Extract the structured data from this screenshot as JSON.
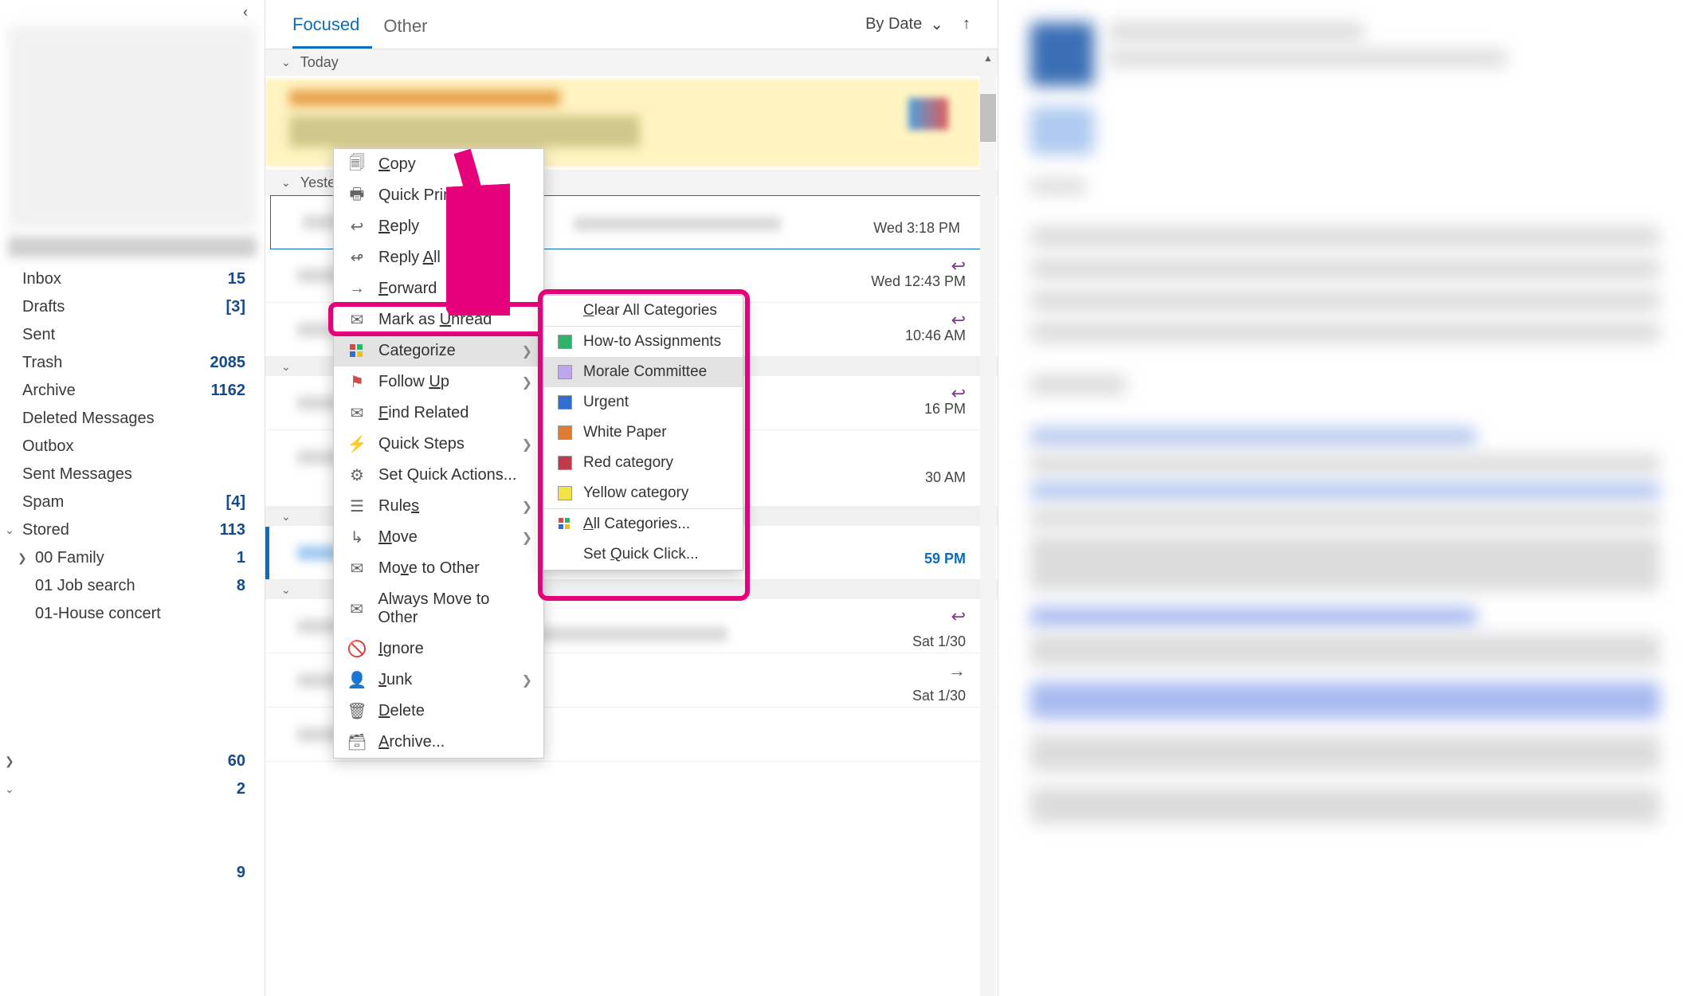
{
  "sidebar": {
    "folders": [
      {
        "name": "Inbox",
        "count": "15"
      },
      {
        "name": "Drafts",
        "count": "[3]"
      },
      {
        "name": "Sent",
        "count": ""
      },
      {
        "name": "Trash",
        "count": "2085"
      },
      {
        "name": "Archive",
        "count": "1162"
      },
      {
        "name": "Deleted Messages",
        "count": ""
      },
      {
        "name": "Outbox",
        "count": ""
      },
      {
        "name": "Sent Messages",
        "count": ""
      },
      {
        "name": "Spam",
        "count": "[4]"
      },
      {
        "name": "Stored",
        "count": "113",
        "expandable": true,
        "expanded": true
      },
      {
        "name": "00 Family",
        "count": "1",
        "level": 1,
        "expandable": true
      },
      {
        "name": "01 Job search",
        "count": "8",
        "level": 1
      },
      {
        "name": "01-House concert",
        "count": "",
        "level": 1
      }
    ],
    "tail_counts": [
      "60",
      "2",
      "9"
    ]
  },
  "tabs": {
    "focused": "Focused",
    "other": "Other"
  },
  "sort_label": "By Date",
  "groups": {
    "today": "Today",
    "yesterday": "Yesterday"
  },
  "messages": {
    "m1_time": "Wed 3:18 PM",
    "m2_time": "Wed 12:43 PM",
    "m3_time": "10:46 AM",
    "m4_time": "16 PM",
    "m5_time": "30 AM",
    "m6_time": "59 PM",
    "m7_time": "Sat 1/30",
    "m8_time": "Sat 1/30"
  },
  "context_menu": [
    {
      "icon": "copy",
      "label": "Copy",
      "key": "C"
    },
    {
      "icon": "print",
      "label": "Quick Print"
    },
    {
      "icon": "reply",
      "label": "Reply",
      "key": "R"
    },
    {
      "icon": "replyall",
      "label": "Reply All",
      "key": "A"
    },
    {
      "icon": "forward",
      "label": "Forward",
      "key": "F"
    },
    {
      "icon": "unread",
      "label": "Mark as Unread",
      "key": "U"
    },
    {
      "icon": "categorize",
      "label": "Categorize",
      "sub": true,
      "highlight": true
    },
    {
      "icon": "flag",
      "label": "Follow Up",
      "key": "U",
      "sub": true
    },
    {
      "icon": "find",
      "label": "Find Related",
      "key": "F"
    },
    {
      "icon": "quick",
      "label": "Quick Steps",
      "sub": true
    },
    {
      "icon": "gear",
      "label": "Set Quick Actions..."
    },
    {
      "icon": "rules",
      "label": "Rules",
      "key": "s",
      "sub": true
    },
    {
      "icon": "move",
      "label": "Move",
      "key": "M",
      "sub": true
    },
    {
      "icon": "moveother",
      "label": "Move to Other",
      "key": "v"
    },
    {
      "icon": "alwaysmove",
      "label": "Always Move to Other"
    },
    {
      "icon": "ignore",
      "label": "Ignore",
      "key": "I"
    },
    {
      "icon": "junk",
      "label": "Junk",
      "key": "J",
      "sub": true
    },
    {
      "icon": "delete",
      "label": "Delete",
      "key": "D"
    },
    {
      "icon": "archive",
      "label": "Archive...",
      "key": "A"
    }
  ],
  "submenu": {
    "clear": "Clear All Categories",
    "cats": [
      {
        "color": "#2fb36b",
        "label": "How-to Assignments"
      },
      {
        "color": "#bda6ee",
        "label": "Morale Committee",
        "hover": true
      },
      {
        "color": "#2f6fd0",
        "label": "Urgent"
      },
      {
        "color": "#e07b2f",
        "label": "White Paper"
      },
      {
        "color": "#c13a4a",
        "label": "Red category"
      },
      {
        "color": "#f3e24a",
        "label": "Yellow category"
      }
    ],
    "all": "All Categories...",
    "quick": "Set Quick Click..."
  }
}
